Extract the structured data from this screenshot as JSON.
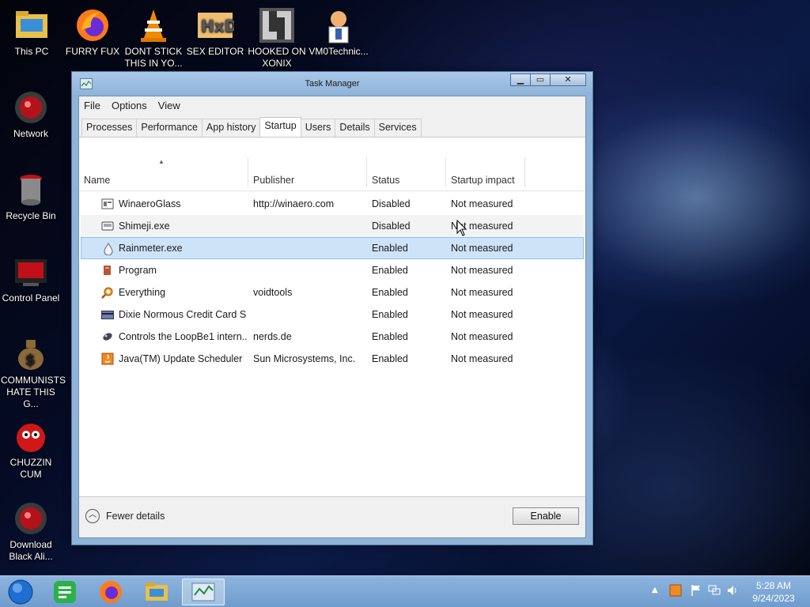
{
  "desktop": {
    "icons": [
      {
        "label": "This PC"
      },
      {
        "label": "FURRY FUX"
      },
      {
        "label": "DONT STICK THIS IN YO..."
      },
      {
        "label": "SEX EDITOR"
      },
      {
        "label": "HOOKED ON XONIX"
      },
      {
        "label": "VM0Technic..."
      },
      {
        "label": "Network"
      },
      {
        "label": "Recycle Bin"
      },
      {
        "label": "Control Panel"
      },
      {
        "label": "COMMUNISTS HATE THIS G..."
      },
      {
        "label": "CHUZZIN CUM"
      },
      {
        "label": "Download Black Ali..."
      }
    ]
  },
  "window": {
    "title": "Task Manager",
    "menu": [
      "File",
      "Options",
      "View"
    ],
    "tabs": [
      "Processes",
      "Performance",
      "App history",
      "Startup",
      "Users",
      "Details",
      "Services"
    ],
    "active_tab": "Startup",
    "columns": [
      "Name",
      "Publisher",
      "Status",
      "Startup impact"
    ],
    "rows": [
      {
        "name": "WinaeroGlass",
        "publisher": "http://winaero.com",
        "status": "Disabled",
        "impact": "Not measured"
      },
      {
        "name": "Shimeji.exe",
        "publisher": "",
        "status": "Disabled",
        "impact": "Not measured"
      },
      {
        "name": "Rainmeter.exe",
        "publisher": "",
        "status": "Enabled",
        "impact": "Not measured"
      },
      {
        "name": "Program",
        "publisher": "",
        "status": "Enabled",
        "impact": "Not measured"
      },
      {
        "name": "Everything",
        "publisher": "voidtools",
        "status": "Enabled",
        "impact": "Not measured"
      },
      {
        "name": "Dixie Normous Credit Card S...",
        "publisher": "",
        "status": "Enabled",
        "impact": "Not measured"
      },
      {
        "name": "Controls the LoopBe1 intern...",
        "publisher": "nerds.de",
        "status": "Enabled",
        "impact": "Not measured"
      },
      {
        "name": "Java(TM) Update Scheduler",
        "publisher": "Sun Microsystems, Inc.",
        "status": "Enabled",
        "impact": "Not measured"
      }
    ],
    "selected_row": "Rainmeter.exe",
    "fewer_details": "Fewer details",
    "enable_button": "Enable"
  },
  "taskbar": {
    "time": "5:28 AM",
    "date": "9/24/2023"
  },
  "colors": {
    "selection": "#cde3f7",
    "window_frame": "#8fb3d9",
    "taskbar": "#7ba6d6"
  }
}
